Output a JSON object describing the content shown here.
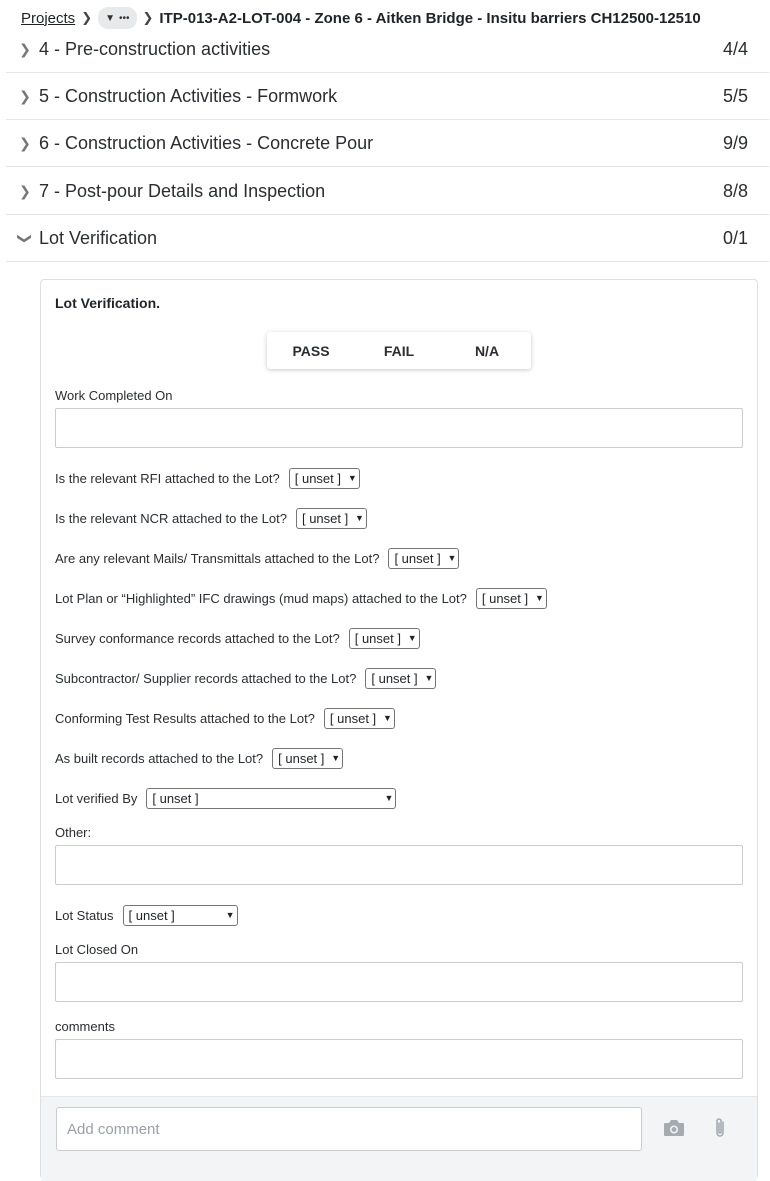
{
  "breadcrumb": {
    "projects_label": "Projects",
    "more_label": "•••",
    "current": "ITP-013-A2-LOT-004 - Zone 6 - Aitken Bridge - Insitu barriers CH12500-12510"
  },
  "sections": [
    {
      "label": "4 - Pre-construction activities",
      "count": "4/4"
    },
    {
      "label": "5 - Construction Activities - Formwork",
      "count": "5/5"
    },
    {
      "label": "6 - Construction Activities - Concrete Pour",
      "count": "9/9"
    },
    {
      "label": "7 - Post-pour Details and Inspection",
      "count": "8/8"
    },
    {
      "label": "Lot Verification",
      "count": "0/1"
    }
  ],
  "panel": {
    "title": "Lot Verification.",
    "buttons": {
      "pass": "PASS",
      "fail": "FAIL",
      "na": "N/A"
    },
    "work_completed_label": "Work Completed On",
    "questions": [
      {
        "label": "Is the relevant RFI attached to the Lot?",
        "value": "[ unset ]"
      },
      {
        "label": "Is the relevant NCR attached to the Lot?",
        "value": "[ unset ]"
      },
      {
        "label": "Are any relevant Mails/ Transmittals attached to the Lot?",
        "value": "[ unset ]"
      },
      {
        "label": "Lot Plan or “Highlighted” IFC drawings (mud maps) attached to the Lot?",
        "value": "[ unset ]"
      },
      {
        "label": "Survey conformance records attached to the Lot?",
        "value": "[ unset ]"
      },
      {
        "label": "Subcontractor/ Supplier records attached to the Lot?",
        "value": "[ unset ]"
      },
      {
        "label": "Conforming Test Results attached to the Lot?",
        "value": "[ unset ]"
      },
      {
        "label": "As built records attached to the Lot?",
        "value": "[ unset ]"
      }
    ],
    "verified_by": {
      "label": "Lot verified By",
      "value": "[ unset ]"
    },
    "other_label": "Other:",
    "status": {
      "label": "Lot Status",
      "value": "[ unset ]"
    },
    "closed_on_label": "Lot Closed On",
    "comments_label": "comments",
    "comment_placeholder": "Add comment"
  }
}
